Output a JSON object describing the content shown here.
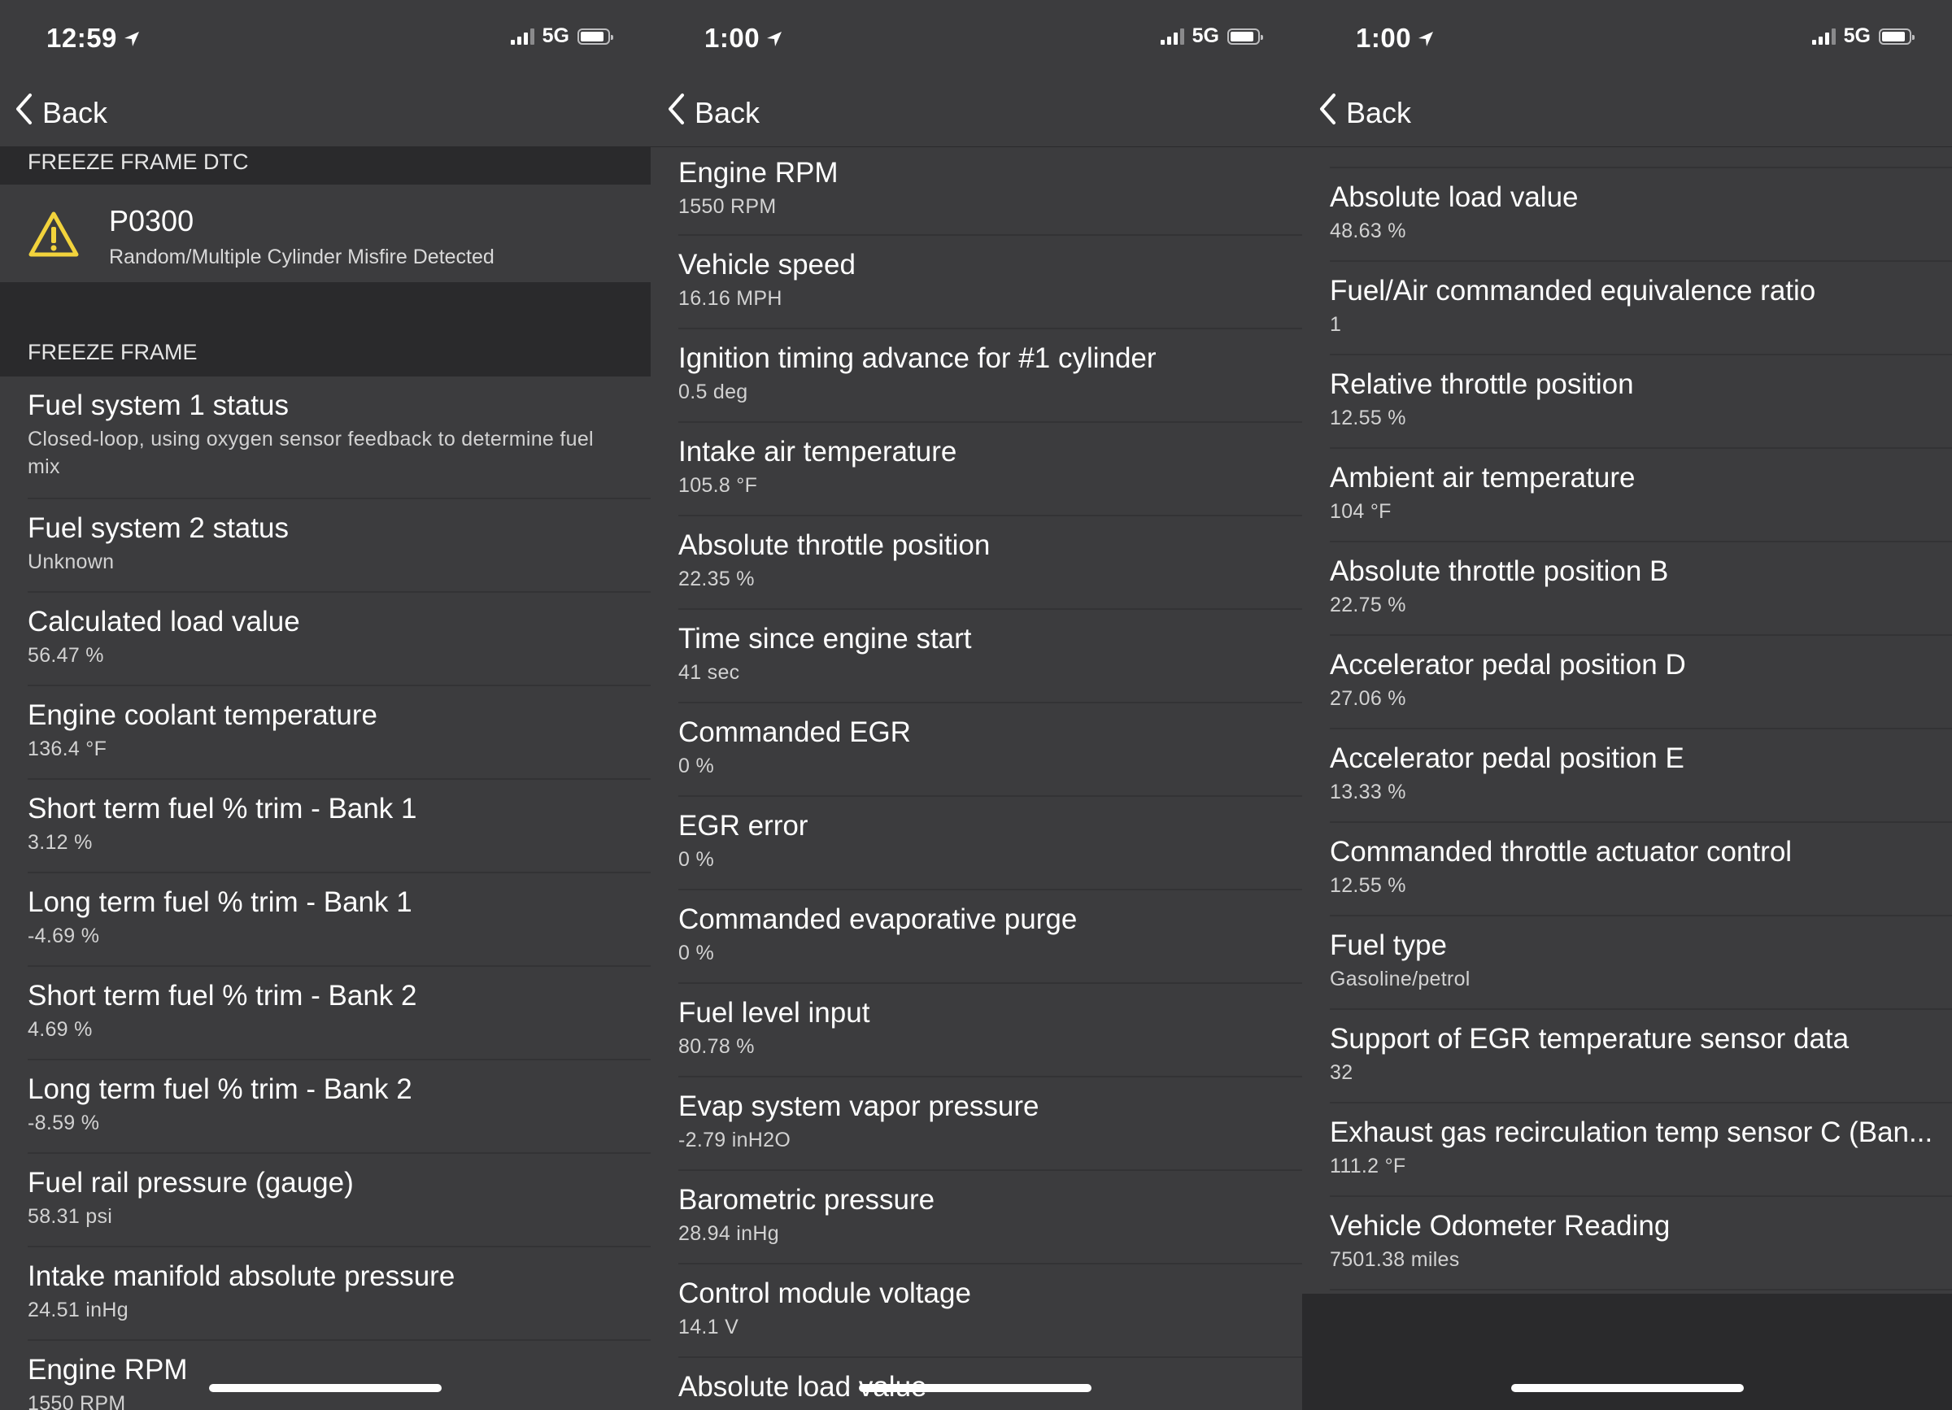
{
  "panels": [
    {
      "time": "12:59",
      "network": "5G",
      "back_label": "Back",
      "dtc_header": "FREEZE FRAME DTC",
      "dtc": {
        "code": "P0300",
        "description": "Random/Multiple Cylinder Misfire Detected",
        "icon": "warning-icon"
      },
      "section_header": "FREEZE FRAME",
      "items": [
        {
          "label": "Fuel system 1 status",
          "value": "Closed-loop, using oxygen sensor feedback to determine fuel mix"
        },
        {
          "label": "Fuel system 2 status",
          "value": "Unknown"
        },
        {
          "label": "Calculated load value",
          "value": "56.47 %"
        },
        {
          "label": "Engine coolant temperature",
          "value": "136.4 °F"
        },
        {
          "label": "Short term fuel % trim - Bank 1",
          "value": "3.12 %"
        },
        {
          "label": "Long term fuel % trim - Bank 1",
          "value": "-4.69 %"
        },
        {
          "label": "Short term fuel % trim - Bank 2",
          "value": "4.69 %"
        },
        {
          "label": "Long term fuel % trim - Bank 2",
          "value": "-8.59 %"
        },
        {
          "label": "Fuel rail pressure (gauge)",
          "value": "58.31 psi"
        },
        {
          "label": "Intake manifold absolute pressure",
          "value": "24.51 inHg"
        },
        {
          "label": "Engine RPM",
          "value": "1550 RPM"
        }
      ]
    },
    {
      "time": "1:00",
      "network": "5G",
      "back_label": "Back",
      "items": [
        {
          "label": "Engine RPM",
          "value": "1550 RPM"
        },
        {
          "label": "Vehicle speed",
          "value": "16.16 MPH"
        },
        {
          "label": "Ignition timing advance for #1 cylinder",
          "value": "0.5 deg"
        },
        {
          "label": "Intake air temperature",
          "value": "105.8 °F"
        },
        {
          "label": "Absolute throttle position",
          "value": "22.35 %"
        },
        {
          "label": "Time since engine start",
          "value": "41 sec"
        },
        {
          "label": "Commanded EGR",
          "value": "0 %"
        },
        {
          "label": "EGR error",
          "value": "0 %"
        },
        {
          "label": "Commanded evaporative purge",
          "value": "0 %"
        },
        {
          "label": "Fuel level input",
          "value": "80.78 %"
        },
        {
          "label": "Evap system vapor pressure",
          "value": "-2.79 inH2O"
        },
        {
          "label": "Barometric pressure",
          "value": "28.94 inHg"
        },
        {
          "label": "Control module voltage",
          "value": "14.1 V"
        },
        {
          "label": "Absolute load value",
          "value": ""
        }
      ]
    },
    {
      "time": "1:00",
      "network": "5G",
      "back_label": "Back",
      "items": [
        {
          "label": "Absolute load value",
          "value": "48.63 %"
        },
        {
          "label": "Fuel/Air commanded equivalence ratio",
          "value": "1"
        },
        {
          "label": "Relative throttle position",
          "value": "12.55 %"
        },
        {
          "label": "Ambient air temperature",
          "value": "104 °F"
        },
        {
          "label": "Absolute throttle position B",
          "value": "22.75 %"
        },
        {
          "label": "Accelerator pedal position D",
          "value": "27.06 %"
        },
        {
          "label": "Accelerator pedal position E",
          "value": "13.33 %"
        },
        {
          "label": "Commanded throttle actuator control",
          "value": "12.55 %"
        },
        {
          "label": "Fuel type",
          "value": "Gasoline/petrol"
        },
        {
          "label": "Support of EGR temperature sensor data",
          "value": "32"
        },
        {
          "label": "Exhaust gas recirculation temp sensor C (Ban...",
          "value": "111.2 °F"
        },
        {
          "label": "Vehicle Odometer Reading",
          "value": "7501.38 miles"
        }
      ]
    }
  ]
}
